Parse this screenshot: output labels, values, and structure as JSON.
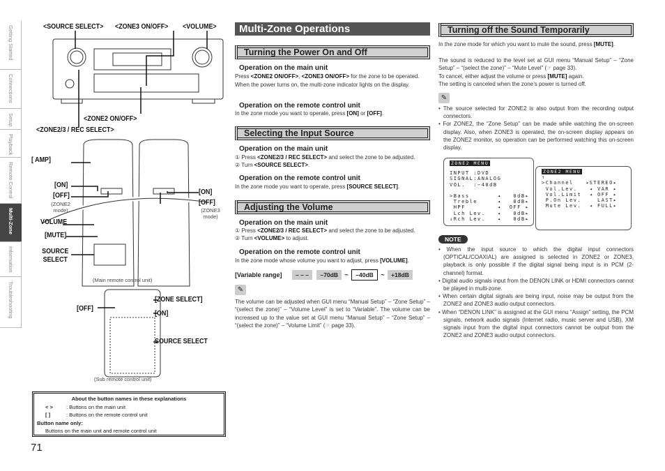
{
  "side_tabs": [
    {
      "label": "Getting Started",
      "active": false
    },
    {
      "label": "Connections",
      "active": false
    },
    {
      "label": "Setup",
      "active": false
    },
    {
      "label": "Playback",
      "active": false
    },
    {
      "label": "Remote Control",
      "active": false
    },
    {
      "label": "Multi-Zone",
      "active": true
    },
    {
      "label": "Information",
      "active": false
    },
    {
      "label": "Troubleshooting",
      "active": false
    }
  ],
  "illustration": {
    "main_unit_labels": {
      "source_select": "<SOURCE SELECT>",
      "zone3_onoff": "<ZONE3 ON/OFF>",
      "volume": "<VOLUME>",
      "zone2_onoff": "<ZONE2 ON/OFF>",
      "zone23_rec": "<ZONE2/3 / REC SELECT>"
    },
    "remote_labels": {
      "amp": "[ AMP]",
      "on_z2": "[ON]",
      "off_z2": "[OFF]",
      "zone2_mode": "(ZONE2 mode)",
      "on_z3": "[ON]",
      "off_z3": "[OFF]",
      "zone3_mode": "(ZONE3 mode)",
      "volume": "VOLUME",
      "mute": "[MUTE]",
      "source_select": "SOURCE SELECT",
      "caption": "(Main remote control unit)"
    },
    "sub_remote_labels": {
      "off": "[OFF]",
      "zone_select": "[ZONE SELECT]",
      "on": "[ON]",
      "source_select": "SOURCE SELECT",
      "caption": "(Sub remote control unit)"
    }
  },
  "legend": {
    "title": "About the button names in these explanations",
    "row1_sym": "<    >",
    "row1": ": Buttons on the main unit",
    "row2_sym": "[    ]",
    "row2": ": Buttons on the remote control unit",
    "only_title": "Button name only:",
    "only_text": "Buttons on the main unit and remote control unit"
  },
  "page_number": "71",
  "title": "Multi-Zone Operations",
  "power": {
    "heading": "Turning the Power On and Off",
    "main_h": "Operation on the main unit",
    "main_p": [
      {
        "t": "Press "
      },
      {
        "t": "<ZONE2 ON/OFF>",
        "b": 1
      },
      {
        "t": ", "
      },
      {
        "t": "<ZONE3 ON/OFF>",
        "b": 1
      },
      {
        "t": " for the zone to be operated."
      }
    ],
    "main_p2": "When the power turns on, the multi-zone indicator lights on the display.",
    "remote_h": "Operation on the remote control unit",
    "remote_p": [
      {
        "t": "In the zone mode you want to operate, press "
      },
      {
        "t": "[ON]",
        "b": 1
      },
      {
        "t": " or "
      },
      {
        "t": "[OFF]",
        "b": 1
      },
      {
        "t": "."
      }
    ]
  },
  "input": {
    "heading": "Selecting the Input Source",
    "main_h": "Operation on the main unit",
    "step1": [
      {
        "t": "① Press "
      },
      {
        "t": "<ZONE2/3 / REC SELECT>",
        "b": 1
      },
      {
        "t": " and select the zone to be adjusted."
      }
    ],
    "step2": [
      {
        "t": "② Turn "
      },
      {
        "t": "<SOURCE SELECT>",
        "b": 1
      },
      {
        "t": "."
      }
    ],
    "remote_h": "Operation on the remote control unit",
    "remote_p": [
      {
        "t": "In the zone mode you want to operate, press "
      },
      {
        "t": "[SOURCE SELECT]",
        "b": 1
      },
      {
        "t": "."
      }
    ]
  },
  "volume": {
    "heading": "Adjusting the Volume",
    "main_h": "Operation on the main unit",
    "step1": [
      {
        "t": "① Press "
      },
      {
        "t": "<ZONE2/3 / REC SELECT>",
        "b": 1
      },
      {
        "t": " and select the zone to be adjusted."
      }
    ],
    "step2": [
      {
        "t": "② Turn "
      },
      {
        "t": "<VOLUME>",
        "b": 1
      },
      {
        "t": " to adjust."
      }
    ],
    "remote_h": "Operation on the remote control unit",
    "remote_p": [
      {
        "t": "In the zone mode whose volume you want to adjust, press "
      },
      {
        "t": "[VOLUME]",
        "b": 1
      },
      {
        "t": "."
      }
    ],
    "range_label": "[Variable range]",
    "range": [
      "– – –",
      "–70dB",
      "~",
      "–40dB",
      "~",
      "+18dB"
    ],
    "tip": "The volume can be adjusted when GUI menu “Manual Setup” – “Zone Setup” – “(select the zone)” – “Volume Level” is set to “Variable”. The volume can be increased up to the value set at GUI menu “Manual Setup” – “Zone Setup” – “(select the zone)” – “Volume Limit” (☞ page 33)."
  },
  "mute": {
    "heading": "Turning off the Sound Temporarily",
    "p1": [
      {
        "t": "In the zone mode for which you want to mute the sound, press "
      },
      {
        "t": "[MUTE]",
        "b": 1
      },
      {
        "t": "."
      }
    ],
    "p2": "The sound is reduced to the level set at GUI menu “Manual Setup” – “Zone Setup” – “(select the zone)” – “Mute Level” (☞ page 33).",
    "p3": [
      {
        "t": "To cancel, either adjust the volume or press "
      },
      {
        "t": "[MUTE]",
        "b": 1
      },
      {
        "t": " again."
      }
    ],
    "p4": "The setting is canceled when the zone’s power is turned off.",
    "tips": [
      "The source selected for ZONE2 is also output from the recording output connectors.",
      "For ZONE2, the “Zone Setup” can be made while watching the on-screen display. Also, when ZONE3 is operated, the on-screen display appears on the ZONE2 monitor, so operation can be performed watching this on-screen display."
    ]
  },
  "osd1": {
    "title": "ZONE2 MENU",
    "lines": "INPUT :DVD\nSIGNAL:ANALOG\nVOL.  :−40dB\n\n>Bass       ◂   0dB▸\n Treble     ◂   0dB▸\n HPF        ◂  OFF ▸\n Lch Lev.   ◂   0dB▸\n↓Rch Lev.   ◂   0dB▸"
  },
  "osd2": {
    "title": "ZONE2 MENU",
    "lines": "↑\n>Channel   ◂STEREO▸\n Vol.Lev.   ◂ VAR ▸\n Vol.Limit  ◂ OFF ▸\n P.On Lev.    LAST▸\n Mute Lev.  ◂ FULL▸"
  },
  "note": {
    "label": "NOTE",
    "items": [
      "When the input source to which the digital input connectors (OPTICAL/COAXIAL) are assigned is selected in ZONE2 or ZONE3, playback is only possible if the digital signal being input is in PCM (2-channel) format.",
      "Digital audio signals input from the DENON LINK or HDMI connectors cannot be played in multi-zone.",
      "When certain digital signals are being input, noise may be output from the ZONE2 and ZONE3 audio output connectors.",
      "When “DENON LINK” is assigned at the GUI menu “Assign” setting, the PCM signals, network audio signals (Internet radio, music server and USB), XM signals input from the digital input connectors cannot be output from the ZONE2 and ZONE3 audio output connectors."
    ]
  }
}
